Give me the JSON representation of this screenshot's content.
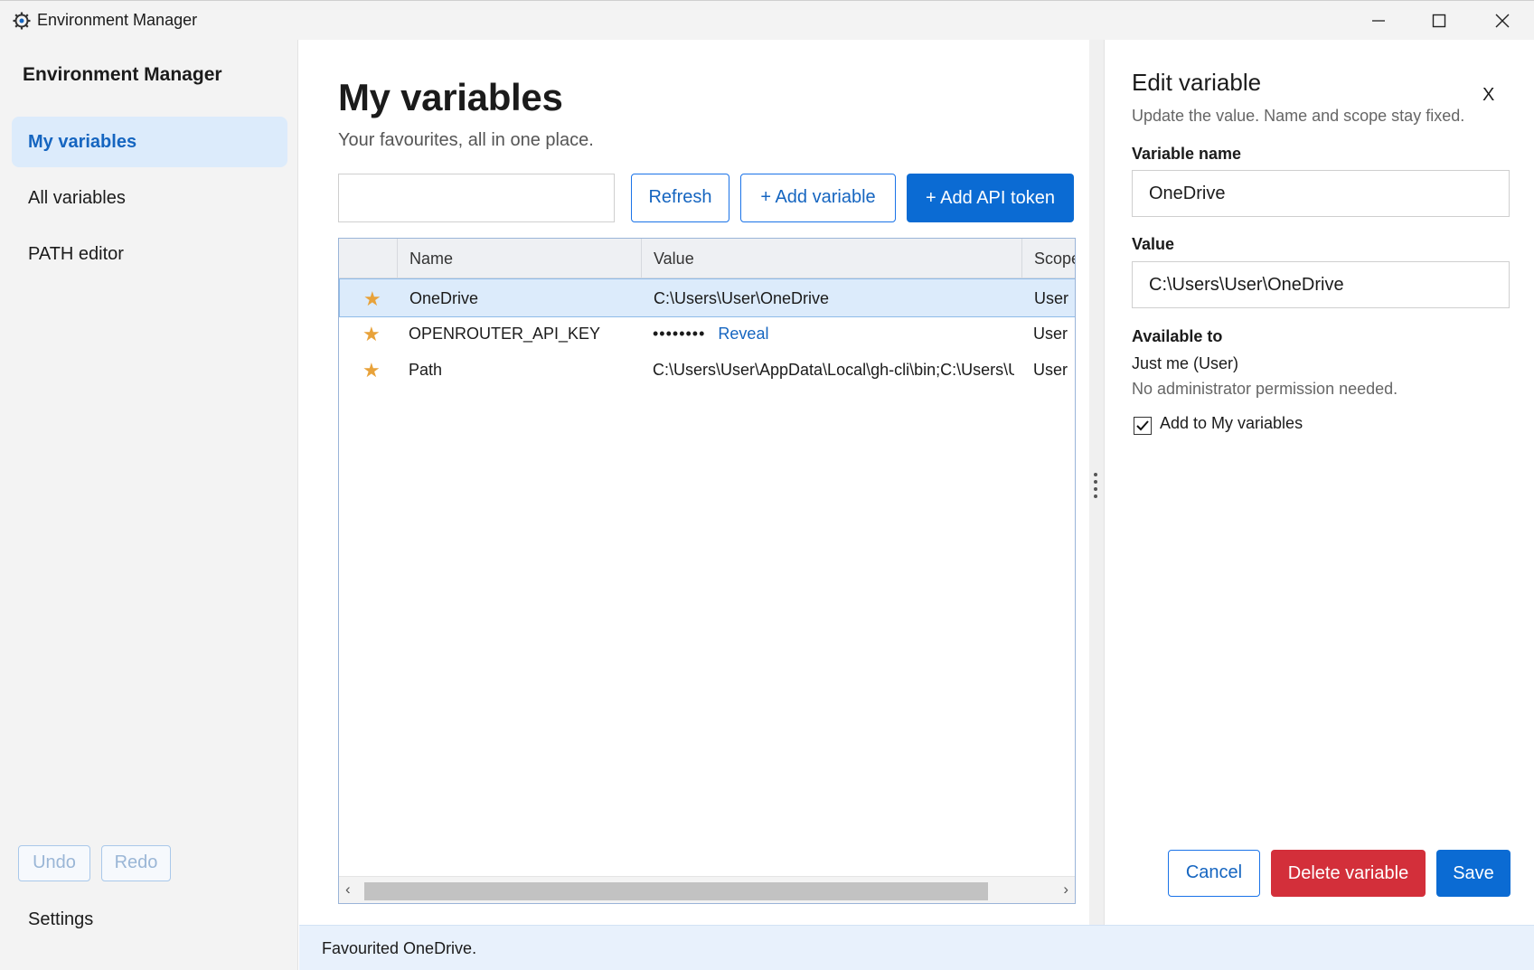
{
  "window": {
    "title": "Environment Manager",
    "icon": "gear-icon"
  },
  "sidebar": {
    "title": "Environment Manager",
    "items": [
      {
        "label": "My variables",
        "active": true
      },
      {
        "label": "All variables",
        "active": false
      },
      {
        "label": "PATH editor",
        "active": false
      }
    ],
    "undo_label": "Undo",
    "redo_label": "Redo",
    "settings_label": "Settings"
  },
  "main": {
    "title": "My variables",
    "subtitle": "Your favourites, all in one place.",
    "search": {
      "value": "",
      "placeholder": ""
    },
    "toolbar": {
      "refresh_label": "Refresh",
      "add_variable_label": "+ Add variable",
      "add_token_label": "+ Add API token"
    },
    "table": {
      "columns": [
        "Name",
        "Value",
        "Scope"
      ],
      "rows": [
        {
          "favourite": true,
          "name": "OneDrive",
          "value": "C:\\Users\\User\\OneDrive",
          "scope": "User",
          "selected": true
        },
        {
          "favourite": true,
          "name": "OPENROUTER_API_KEY",
          "value": "••••••••",
          "reveal_label": "Reveal",
          "scope": "User",
          "selected": false
        },
        {
          "favourite": true,
          "name": "Path",
          "value": "C:\\Users\\User\\AppData\\Local\\gh-cli\\bin;C:\\Users\\U",
          "scope": "User",
          "selected": false
        }
      ]
    }
  },
  "edit_panel": {
    "title": "Edit variable",
    "close_label": "X",
    "subtitle": "Update the value. Name and scope stay fixed.",
    "name_label": "Variable name",
    "name_value": "OneDrive",
    "value_label": "Value",
    "value_value": "C:\\Users\\User\\OneDrive",
    "available_label": "Available to",
    "available_value": "Just me (User)",
    "available_note": "No administrator permission needed.",
    "add_to_my_label": "Add to My variables",
    "add_to_my_checked": true,
    "cancel_label": "Cancel",
    "delete_label": "Delete variable",
    "save_label": "Save"
  },
  "status": {
    "text": "Favourited OneDrive."
  },
  "colors": {
    "accent": "#0b6bd3",
    "danger": "#d32f3a",
    "star": "#e8a23a",
    "selection": "#dcebfb"
  }
}
